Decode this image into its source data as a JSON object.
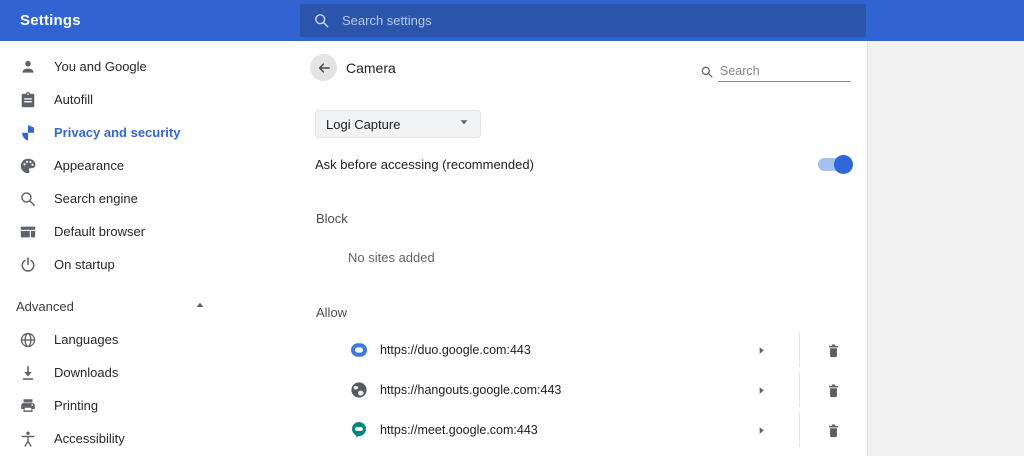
{
  "colors": {
    "header_blue": "#3164d2",
    "searchbox_blue": "#2a55aa",
    "accent_blue": "#3467d1",
    "toggle_track": "#a6c0f2",
    "toggle_knob": "#2d68d8",
    "duo_blue": "#3d7ae0",
    "meet_teal": "#00897b",
    "icon_gray": "#5f6368"
  },
  "titlebar": {
    "title": "Settings",
    "search_placeholder": "Search settings"
  },
  "sidebar": {
    "items": [
      {
        "label": "You and Google",
        "icon": "person-icon",
        "active": false
      },
      {
        "label": "Autofill",
        "icon": "autofill-icon",
        "active": false
      },
      {
        "label": "Privacy and security",
        "icon": "shield-icon",
        "active": true
      },
      {
        "label": "Appearance",
        "icon": "palette-icon",
        "active": false
      },
      {
        "label": "Search engine",
        "icon": "search-icon",
        "active": false
      },
      {
        "label": "Default browser",
        "icon": "browser-icon",
        "active": false
      },
      {
        "label": "On startup",
        "icon": "power-icon",
        "active": false
      }
    ],
    "advanced": {
      "label": "Advanced",
      "expanded": true
    },
    "advanced_items": [
      {
        "label": "Languages",
        "icon": "globe-icon"
      },
      {
        "label": "Downloads",
        "icon": "download-icon"
      },
      {
        "label": "Printing",
        "icon": "printer-icon"
      },
      {
        "label": "Accessibility",
        "icon": "accessibility-icon"
      }
    ]
  },
  "content": {
    "title": "Camera",
    "page_search_placeholder": "Search",
    "device_select": {
      "value": "Logi Capture"
    },
    "ask_row": {
      "label": "Ask before accessing (recommended)",
      "toggle_on": true
    },
    "block": {
      "title": "Block",
      "empty_text": "No sites added"
    },
    "allow": {
      "title": "Allow",
      "sites": [
        {
          "url": "https://duo.google.com:443",
          "icon": "duo-favicon"
        },
        {
          "url": "https://hangouts.google.com:443",
          "icon": "globe-favicon"
        },
        {
          "url": "https://meet.google.com:443",
          "icon": "meet-favicon"
        }
      ]
    }
  }
}
